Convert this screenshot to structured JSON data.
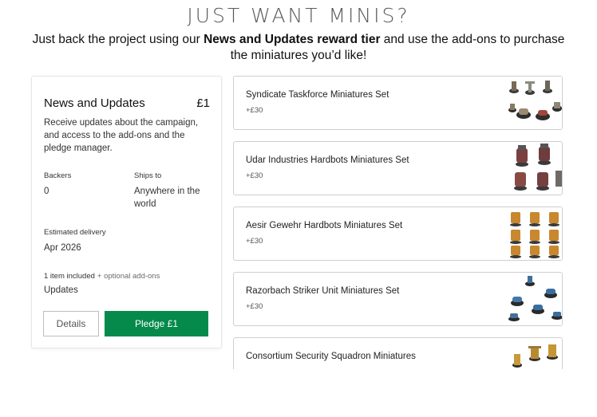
{
  "headline": "JUST WANT MINIS?",
  "subline": {
    "before": "Just back the project using our ",
    "bold": "News and Updates reward tier",
    "after": " and use the add-ons to purchase the miniatures you’d like!"
  },
  "reward": {
    "title": "News and Updates",
    "price": "£1",
    "description": "Receive updates about the campaign, and access to the add-ons and the pledge manager.",
    "backers_label": "Backers",
    "backers_value": "0",
    "ships_label": "Ships to",
    "ships_value": "Anywhere in the world",
    "delivery_label": "Estimated delivery",
    "delivery_value": "Apr 2026",
    "included_label": "1 item included",
    "optional_label": "+ optional add-ons",
    "included_item": "Updates",
    "details_button": "Details",
    "pledge_button": "Pledge £1"
  },
  "addons": [
    {
      "name": "Syndicate Taskforce Miniatures Set",
      "price": "+£30",
      "thumb": "syndicate-minis"
    },
    {
      "name": "Udar Industries Hardbots Miniatures Set",
      "price": "+£30",
      "thumb": "udar-minis"
    },
    {
      "name": "Aesir Gewehr Hardbots Miniatures Set",
      "price": "+£30",
      "thumb": "aesir-minis"
    },
    {
      "name": "Razorbach Striker Unit Miniatures Set",
      "price": "+£30",
      "thumb": "razorbach-minis"
    },
    {
      "name": "Consortium Security Squadron Miniatures",
      "price": "",
      "thumb": "consortium-minis"
    }
  ],
  "colors": {
    "pledge_green": "#058a4b",
    "headline_gray": "#5a5a5a",
    "border": "#cfcfcf"
  }
}
